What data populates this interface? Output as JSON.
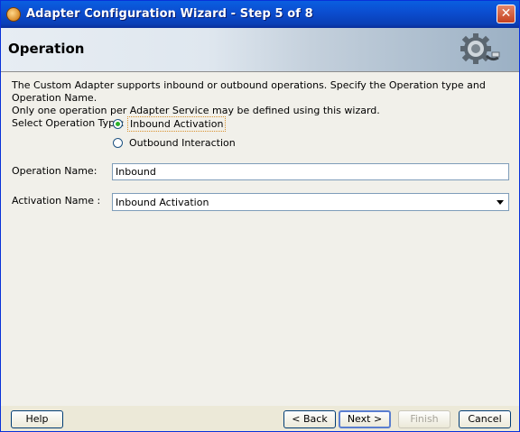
{
  "window": {
    "title": "Adapter Configuration Wizard - Step 5 of 8",
    "close_label": "✕"
  },
  "header": {
    "title": "Operation",
    "graphic_icon": "gear-plug-icon"
  },
  "content": {
    "description_line1": "The Custom Adapter supports inbound or outbound operations.  Specify the Operation type and Operation Name.",
    "description_line2": "Only one operation per Adapter Service may be defined using this wizard.",
    "operation_type_label": "Select Operation Type:",
    "operation_types": [
      {
        "label": "Inbound Activation",
        "selected": true
      },
      {
        "label": "Outbound Interaction",
        "selected": false
      }
    ],
    "operation_name_label": "Operation Name:",
    "operation_name_value": "Inbound",
    "activation_name_label": "Activation Name :",
    "activation_name_value": "Inbound Activation"
  },
  "buttons": {
    "help": "Help",
    "back": "< Back",
    "next": "Next >",
    "finish": "Finish",
    "cancel": "Cancel"
  },
  "colors": {
    "titlebar": "#0a4fd0",
    "radio_selected": "#2bb12b",
    "focus_border": "#d9902b"
  }
}
